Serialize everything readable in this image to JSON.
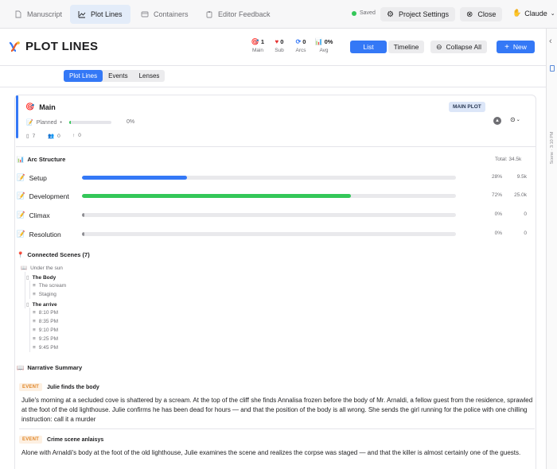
{
  "topbar": {
    "tabs": [
      {
        "label": "Manuscript",
        "icon": "document-icon"
      },
      {
        "label": "Plot Lines",
        "icon": "chart-line-icon",
        "active": true
      },
      {
        "label": "Containers",
        "icon": "box-icon"
      },
      {
        "label": "Editor Feedback",
        "icon": "clipboard-icon"
      }
    ],
    "saved_label": "Saved",
    "project_settings_label": "Project Settings",
    "close_label": "Close",
    "user_label": "Claude"
  },
  "rail": {
    "vertical_label": "Scene · 3:10 PM"
  },
  "header": {
    "title": "PLOT LINES",
    "stats": [
      {
        "value": "1",
        "label": "Main"
      },
      {
        "value": "0",
        "label": "Sub"
      },
      {
        "value": "0",
        "label": "Arcs"
      },
      {
        "value": "0%",
        "label": "Avg"
      }
    ],
    "view_list_label": "List",
    "view_timeline_label": "Timeline",
    "collapse_label": "Collapse All",
    "new_label": "New"
  },
  "subtabs": [
    "Plot Lines",
    "Events",
    "Lenses"
  ],
  "plot": {
    "title": "Main",
    "badge": "MAIN PLOT",
    "status": "Planned",
    "progress_percent": 3,
    "progress_label": "0%",
    "meta": {
      "docs": "7",
      "people": "0",
      "pins": "0"
    },
    "accent_color": "#3478f6"
  },
  "arc_structure": {
    "heading": "Arc Structure",
    "total": "Total: 34.5k",
    "rows": [
      {
        "label": "Setup",
        "percent_value": 28,
        "percent": "28%",
        "words": "9.5k",
        "color": "#3478f6"
      },
      {
        "label": "Development",
        "percent_value": 72,
        "percent": "72%",
        "words": "25.0k",
        "color": "#34c759"
      },
      {
        "label": "Climax",
        "percent_value": 0,
        "percent": "0%",
        "words": "0",
        "color": "#8e8e93"
      },
      {
        "label": "Resolution",
        "percent_value": 0,
        "percent": "0%",
        "words": "0",
        "color": "#8e8e93"
      }
    ]
  },
  "connected_scenes": {
    "heading": "Connected Scenes (7)",
    "root": "Under the sun",
    "chapters": [
      {
        "title": "The Body",
        "scenes": [
          "The scream",
          "Staging"
        ]
      },
      {
        "title": "The arrive",
        "scenes": [
          "8:10 PM",
          "8:35 PM",
          "9:10 PM",
          "9:25 PM",
          "9:45 PM"
        ]
      }
    ]
  },
  "narrative": {
    "heading": "Narrative Summary",
    "events": [
      {
        "tag": "EVENT",
        "title": "Julie finds the body",
        "body": "Julie's morning at a secluded cove is shattered by a scream. At the top of the cliff she finds Annalisa frozen before the body of Mr. Arnaldi, a fellow guest from the residence, sprawled at the foot of the old lighthouse. Julie confirms he has been dead for hours — and that the position of the body is all wrong. She sends the girl running for the police with one chilling instruction: call it a murder"
      },
      {
        "tag": "EVENT",
        "title": "Crime scene anlaisys",
        "body": "Alone with Arnaldi's body at the foot of the old lighthouse, Julie examines the scene and realizes the corpse was staged — and that the killer is almost certainly one of the guests."
      }
    ]
  }
}
